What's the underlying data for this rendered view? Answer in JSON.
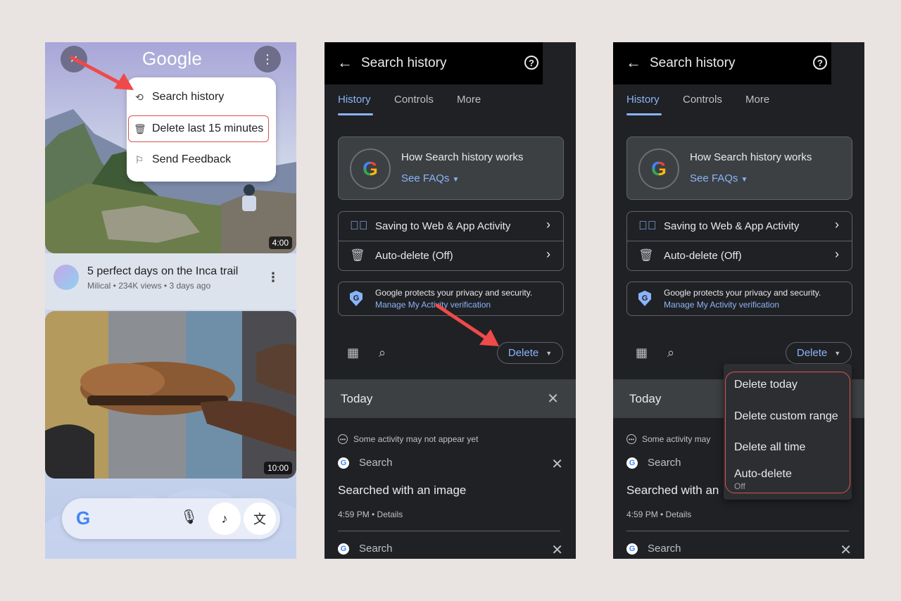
{
  "panel1": {
    "brand": "Google",
    "close_icon": "×",
    "more_icon": "⋮",
    "menu": {
      "items": [
        {
          "label": "Search history",
          "icon": "history-icon"
        },
        {
          "label": "Delete last 15 minutes",
          "icon": "delete-clock-icon"
        },
        {
          "label": "Send Feedback",
          "icon": "feedback-icon"
        }
      ]
    },
    "video1": {
      "duration": "4:00",
      "title": "5 perfect days on the Inca trail",
      "subtitle": "Milical • 234K views • 3 days ago"
    },
    "video2": {
      "duration": "10:00"
    },
    "search_bar": {
      "logo": "G",
      "mic": "mic-icon",
      "music": "music-note-icon",
      "translate": "translate-icon"
    }
  },
  "history": {
    "title": "Search history",
    "tabs": [
      "History",
      "Controls",
      "More"
    ],
    "faq_title": "How Search history works",
    "faq_link": "See FAQs",
    "rows": [
      {
        "label": "Saving to Web & App Activity",
        "icon": "check-circle-icon"
      },
      {
        "label": "Auto-delete (Off)",
        "icon": "auto-delete-icon"
      }
    ],
    "privacy_text": "Google protects your privacy and security.",
    "privacy_link": "Manage My Activity verification",
    "delete_label": "Delete",
    "today_label": "Today",
    "notice": "Some activity may not appear yet",
    "notice_short": "Some activity may",
    "search_label": "Search",
    "searched_text": "Searched with an image",
    "searched_short": "Searched with an",
    "time_text": "4:59 PM • Details"
  },
  "dropdown": {
    "items": [
      "Delete today",
      "Delete custom range",
      "Delete all time",
      "Auto-delete"
    ],
    "auto_delete_sub": "Off"
  },
  "colors": {
    "accent": "#8ab4f8",
    "highlight": "#d9534f",
    "arrow": "#ef4a4a",
    "dark_bg": "#202124"
  }
}
